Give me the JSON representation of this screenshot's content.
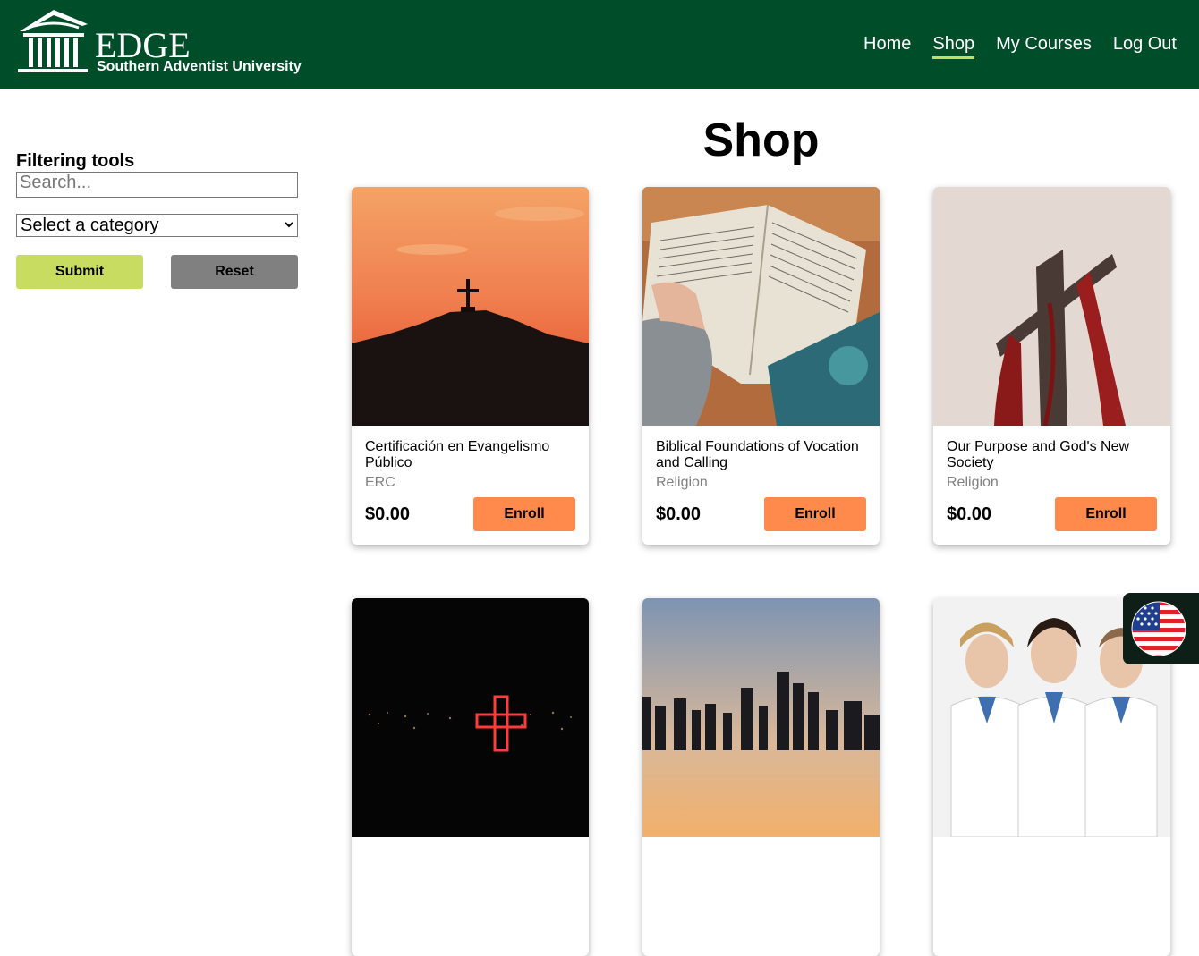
{
  "header": {
    "logo_title": "EDGE",
    "logo_subtitle": "Southern Adventist University",
    "nav": [
      {
        "label": "Home",
        "active": false
      },
      {
        "label": "Shop",
        "active": true
      },
      {
        "label": "My Courses",
        "active": false
      },
      {
        "label": "Log Out",
        "active": false
      }
    ]
  },
  "sidebar": {
    "title": "Filtering tools",
    "search_placeholder": "Search...",
    "category_select": "Select a category",
    "submit_label": "Submit",
    "reset_label": "Reset"
  },
  "main": {
    "title": "Shop",
    "courses": [
      {
        "name": "Certificación en Evangelismo Público",
        "category": "ERC",
        "price": "$0.00",
        "enroll_label": "Enroll"
      },
      {
        "name": "Biblical Foundations of Vocation and Calling",
        "category": "Religion",
        "price": "$0.00",
        "enroll_label": "Enroll"
      },
      {
        "name": "Our Purpose and God's New Society",
        "category": "Religion",
        "price": "$0.00",
        "enroll_label": "Enroll"
      }
    ]
  },
  "colors": {
    "header_bg": "#004d2a",
    "accent": "#c9dc62",
    "enroll": "#ff8a4c",
    "reset": "#808080"
  },
  "icons": {
    "language": "us-flag-icon"
  }
}
